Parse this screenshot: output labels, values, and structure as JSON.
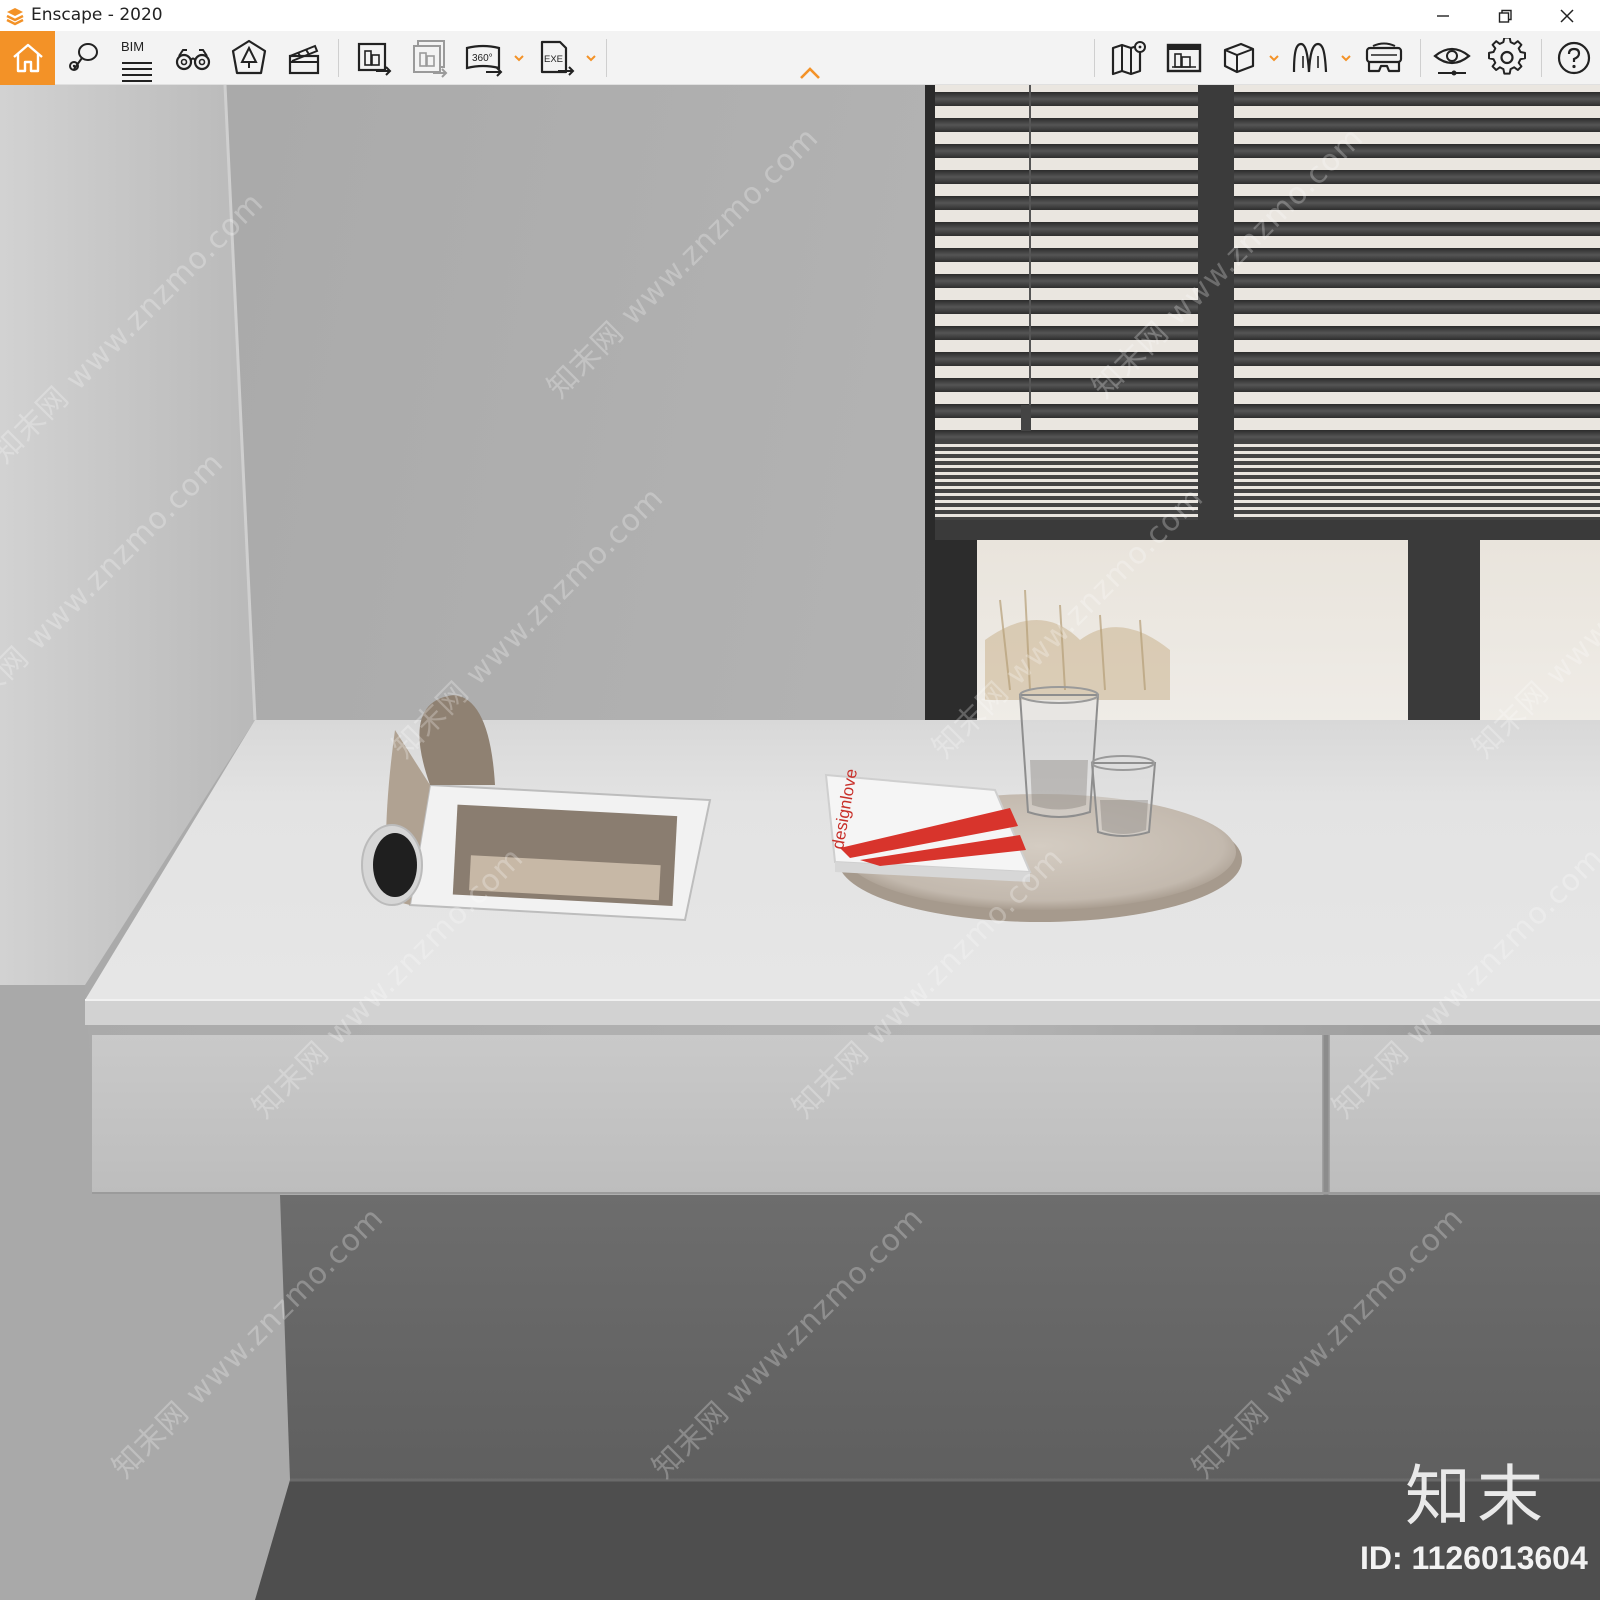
{
  "window": {
    "title": "Enscape - 2020",
    "accent_color": "#f39227",
    "controls": [
      {
        "name": "minimize-icon"
      },
      {
        "name": "restore-icon"
      },
      {
        "name": "close-icon"
      }
    ]
  },
  "toolbar": {
    "left_tools": [
      {
        "name": "home-icon",
        "active": true
      },
      {
        "name": "views-pin-icon"
      },
      {
        "name": "bim-icon",
        "label": "BIM"
      },
      {
        "name": "binoculars-icon"
      },
      {
        "name": "atmosphere-tree-icon"
      },
      {
        "name": "video-editor-clapper-icon"
      },
      {
        "name": "render-image-icon"
      },
      {
        "name": "batch-render-icon"
      },
      {
        "name": "panorama-360-icon",
        "label": "360°",
        "has_dropdown": true
      },
      {
        "name": "export-exe-icon",
        "label": "EXE",
        "has_dropdown": true
      }
    ],
    "right_tools": [
      {
        "name": "map-icon"
      },
      {
        "name": "asset-library-icon"
      },
      {
        "name": "cube-view-icon",
        "has_dropdown": true
      },
      {
        "name": "light-view-icon",
        "has_dropdown": true
      },
      {
        "name": "vr-headset-icon"
      },
      {
        "name": "visual-settings-eye-icon"
      },
      {
        "name": "settings-gear-icon"
      },
      {
        "name": "help-icon"
      }
    ],
    "collapse_arrow": "chevron-up-icon"
  },
  "viewport": {
    "scene_objects": [
      "wall",
      "window-blinds",
      "window",
      "desk",
      "desk-drawer",
      "open-magazine",
      "wooden-tray",
      "designlove-book",
      "drinking-glass"
    ],
    "book_cover_text": "designlove",
    "watermark_text": "知末网 www.znzmo.com",
    "brand_text": "知末",
    "image_id": "ID: 1126013604"
  }
}
